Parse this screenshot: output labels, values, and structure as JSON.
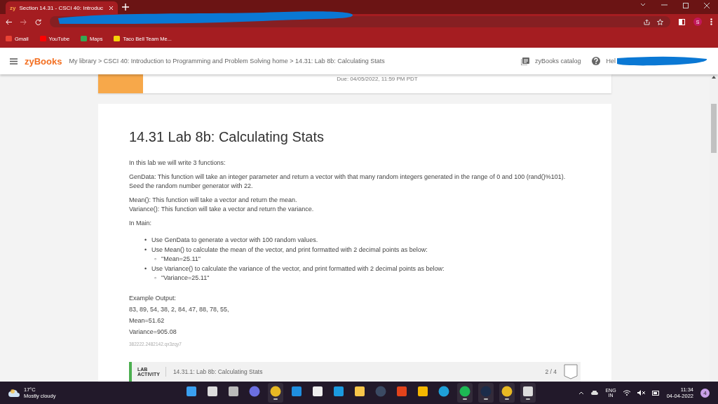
{
  "browser": {
    "tab": {
      "title": "Section 14.31 - CSCI 40: Introduc",
      "favicon": "zy",
      "selected": true
    },
    "bookmarks": [
      {
        "kind": "gmail",
        "label": "Gmail"
      },
      {
        "kind": "youtube",
        "label": "YouTube"
      },
      {
        "kind": "maps",
        "label": "Maps"
      },
      {
        "kind": "chat",
        "label": "Taco Bell Team Me..."
      }
    ],
    "profile": "S"
  },
  "header": {
    "logo": "zyBooks",
    "breadcrumb": "My library > CSCI 40: Introduction to Programming and Problem Solving home > 14.31: Lab 8b: Calculating Stats",
    "catalog": "zyBooks catalog",
    "help": "Hel"
  },
  "due": "Due: 04/05/2022, 11:59 PM PDT",
  "section": {
    "title": "14.31 Lab 8b: Calculating Stats",
    "paragraphs": [
      "In this lab we will write 3 functions:",
      "GenData: This function will take an integer parameter and return a vector with that many random integers generated in the range of 0 and 100 (rand()%101). Seed the random number generator with 22."
    ],
    "functions": [
      "Mean(): This function will take a vector and return the mean.",
      "Variance(): This function will take a vector and return the variance."
    ],
    "main_label": "In Main:",
    "bullets": [
      {
        "marker": "•",
        "text": "Use GenData to generate a vector with 100 random values."
      },
      {
        "marker": "•",
        "text": "Use Mean() to calculate the mean of the vector, and print formatted with 2 decimal points as below:",
        "children": [
          {
            "marker": "◦",
            "text": "\"Mean=25.11\""
          }
        ]
      },
      {
        "marker": "•",
        "text": "Use Variance() to calculate the variance of the vector, and print formatted with 2 decimal points as below:",
        "children": [
          {
            "marker": "◦",
            "text": "\"Variance=25.11\""
          }
        ]
      }
    ],
    "example": [
      "Example Output:",
      "83, 89, 54, 38, 2, 84, 47, 88, 78, 55,",
      "Mean=51.62",
      "Variance=905.08"
    ],
    "code_id": "382222.2482142.qx3zqy7"
  },
  "lab_activity": {
    "label_top": "LAB",
    "label_bottom": "ACTIVITY",
    "title": "14.31.1: Lab 8b: Calculating Stats",
    "progress": "2 / 4"
  },
  "taskbar": {
    "weather": {
      "temp": "17°C",
      "condition": "Mostly cloudy"
    },
    "apps": [
      {
        "kind": "start",
        "running": false
      },
      {
        "kind": "search",
        "running": false
      },
      {
        "kind": "taskview",
        "running": false
      },
      {
        "kind": "chat",
        "running": false
      },
      {
        "kind": "chrome",
        "running": true
      },
      {
        "kind": "mail",
        "running": false
      },
      {
        "kind": "store",
        "running": false
      },
      {
        "kind": "l",
        "running": false
      },
      {
        "kind": "folder",
        "running": false
      },
      {
        "kind": "speed",
        "running": false
      },
      {
        "kind": "office",
        "running": false
      },
      {
        "kind": "rockstar",
        "running": false
      },
      {
        "kind": "edge",
        "running": false
      },
      {
        "kind": "spotify",
        "running": true
      },
      {
        "kind": "steam",
        "running": true
      },
      {
        "kind": "chrome",
        "running": true
      },
      {
        "kind": "snip",
        "running": true
      }
    ],
    "language": "ENG",
    "region": "IN",
    "time": "11:34",
    "date": "04-04-2022",
    "notifications": "4"
  }
}
